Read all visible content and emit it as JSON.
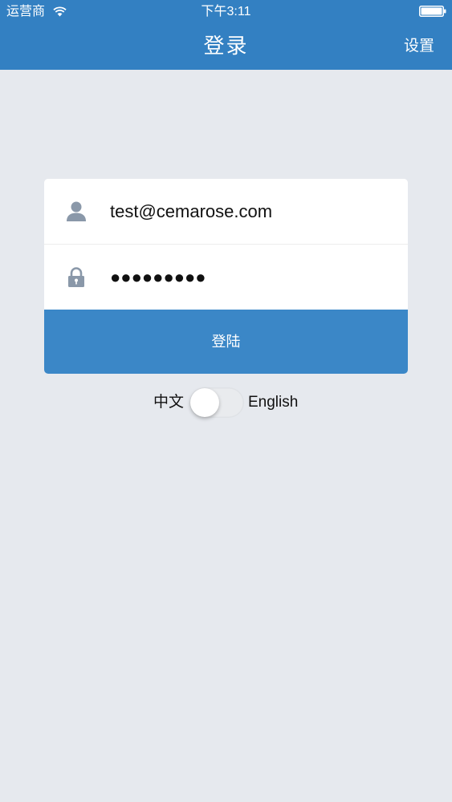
{
  "status_bar": {
    "carrier": "运营商",
    "time": "下午3:11"
  },
  "nav": {
    "title": "登录",
    "settings_label": "设置"
  },
  "login": {
    "username_value": "test@cemarose.com",
    "password_masked": "●●●●●●●●●",
    "submit_label": "登陆"
  },
  "language": {
    "left_label": "中文",
    "right_label": "English",
    "toggle_on": false
  },
  "colors": {
    "nav_bar": "#3380c2",
    "button": "#3b87c7",
    "background": "#e6e9ee",
    "icon": "#8a98a9"
  },
  "icons": {
    "username": "person-icon",
    "password": "lock-icon"
  }
}
